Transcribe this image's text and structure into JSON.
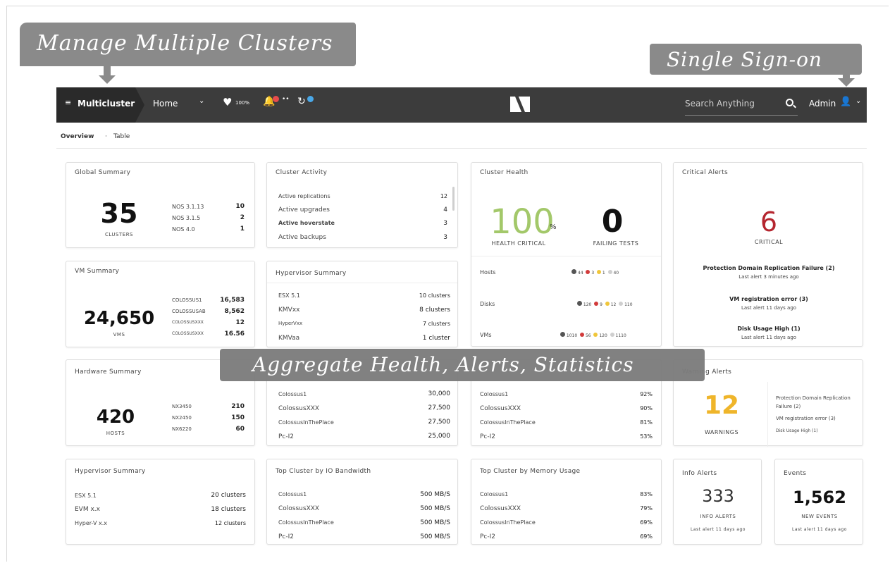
{
  "callouts": {
    "manage_multiple_clusters": "Manage Multiple Clusters",
    "single_sign_on": "Single Sign-on",
    "aggregate": "Aggregate Health, Alerts, Statistics"
  },
  "topbar": {
    "brand": "Multicluster",
    "home": "Home",
    "health_pct": "100%",
    "alerts_counter": "••",
    "search_placeholder": "Search Anything",
    "admin": "Admin"
  },
  "subnav": {
    "overview": "Overview",
    "separator": "·",
    "table": "Table"
  },
  "global_summary": {
    "title": "Global Summary",
    "value": "35",
    "label": "CLUSTERS",
    "rows": [
      {
        "name": "NOS 3.1.13",
        "value": "10"
      },
      {
        "name": "NOS 3.1.5",
        "value": "2"
      },
      {
        "name": "NOS 4.0",
        "value": "1"
      }
    ]
  },
  "cluster_activity": {
    "title": "Cluster Activity",
    "rows": [
      {
        "name": "Active replications",
        "value": "12"
      },
      {
        "name": "Active upgrades",
        "value": "4"
      },
      {
        "name": "Active hoverstate",
        "value": "3"
      },
      {
        "name": "Active backups",
        "value": "3"
      }
    ]
  },
  "cluster_health": {
    "title": "Cluster Health",
    "health_value": "100",
    "health_unit": "%",
    "health_label": "HEALTH CRITICAL",
    "failing_value": "0",
    "failing_label": "FAILING TESTS",
    "rows": [
      {
        "name": "Hosts",
        "counts": [
          "44",
          "3",
          "1",
          "40"
        ]
      },
      {
        "name": "Disks",
        "counts": [
          "120",
          "9",
          "12",
          "110"
        ]
      },
      {
        "name": "VMs",
        "counts": [
          "1010",
          "56",
          "120",
          "1110"
        ]
      }
    ]
  },
  "critical_alerts": {
    "title": "Critical Alerts",
    "value": "6",
    "label": "CRITICAL",
    "items": [
      {
        "name": "Protection Domain Replication Failure (2)",
        "meta": "Last alert 3 minutes ago"
      },
      {
        "name": "VM registration error (3)",
        "meta": "Last alert 11 days ago"
      },
      {
        "name": "Disk Usage High (1)",
        "meta": "Last alert 11 days ago"
      }
    ]
  },
  "vm_summary": {
    "title": "VM Summary",
    "value": "24,650",
    "label": "VMS",
    "rows": [
      {
        "name": "COLOSSUS1",
        "value": "16,583"
      },
      {
        "name": "COLOSSUSAB",
        "value": "8,562"
      },
      {
        "name": "COLOSSUSXXX",
        "value": "12"
      },
      {
        "name": "COLOSSUSXXX",
        "value": "16.56"
      }
    ]
  },
  "hypervisor_summary_top": {
    "title": "Hypervisor Summary",
    "rows": [
      {
        "name": "ESX 5.1",
        "value": "10 clusters"
      },
      {
        "name": "KMVxx",
        "value": "8 clusters"
      },
      {
        "name": "HyperVxx",
        "value": "7 clusters"
      },
      {
        "name": "KMVaa",
        "value": "1 cluster"
      }
    ]
  },
  "hardware_summary": {
    "title": "Hardware Summary",
    "value": "420",
    "label": "HOSTS",
    "rows": [
      {
        "name": "NX3450",
        "value": "210"
      },
      {
        "name": "NX2450",
        "value": "150"
      },
      {
        "name": "NX6220",
        "value": "60"
      }
    ]
  },
  "top_iops": {
    "rows": [
      {
        "name": "Colossus1",
        "value": "30,000"
      },
      {
        "name": "ColossusXXX",
        "value": "27,500"
      },
      {
        "name": "ColossusInThePlace",
        "value": "27,500"
      },
      {
        "name": "Pc-I2",
        "value": "25,000"
      }
    ]
  },
  "top_cpu": {
    "rows": [
      {
        "name": "Colossus1",
        "value": "92%"
      },
      {
        "name": "ColossusXXX",
        "value": "90%"
      },
      {
        "name": "ColossusInThePlace",
        "value": "81%"
      },
      {
        "name": "Pc-I2",
        "value": "53%"
      }
    ]
  },
  "warning_alerts": {
    "title": "Warning Alerts",
    "value": "12",
    "label": "WARNINGS",
    "items": [
      "Protection Domain Replication Failure (2)",
      "VM registration error (3)",
      "Disk Usage High (1)"
    ]
  },
  "hypervisor_summary_bottom": {
    "title": "Hypervisor Summary",
    "rows": [
      {
        "name": "ESX 5.1",
        "value": "20 clusters"
      },
      {
        "name": "EVM x.x",
        "value": "18 clusters"
      },
      {
        "name": "Hyper-V x.x",
        "value": "12 clusters"
      }
    ]
  },
  "top_io_bandwidth": {
    "title": "Top Cluster by IO Bandwidth",
    "rows": [
      {
        "name": "Colossus1",
        "value": "500 MB/S"
      },
      {
        "name": "ColossusXXX",
        "value": "500 MB/S"
      },
      {
        "name": "ColossusInThePlace",
        "value": "500 MB/S"
      },
      {
        "name": "Pc-I2",
        "value": "500 MB/S"
      }
    ]
  },
  "top_memory": {
    "title": "Top Cluster by Memory Usage",
    "rows": [
      {
        "name": "Colossus1",
        "value": "83%"
      },
      {
        "name": "ColossusXXX",
        "value": "79%"
      },
      {
        "name": "ColossusInThePlace",
        "value": "69%"
      },
      {
        "name": "Pc-I2",
        "value": "69%"
      }
    ]
  },
  "info_alerts": {
    "title": "Info Alerts",
    "value": "333",
    "label": "INFO ALERTS",
    "meta": "Last alert 11 days ago"
  },
  "events": {
    "title": "Events",
    "value": "1,562",
    "label": "NEW EVENTS",
    "meta": "Last alert 11 days ago"
  },
  "colors": {
    "health_green": "#a3c86a",
    "critical_red": "#b5262f",
    "warning_yellow": "#efb52a",
    "dot_red": "#d23b3b",
    "dot_yellow": "#f0c63a",
    "dot_gray": "#cfcfcf",
    "dot_dark": "#555555",
    "topbar": "#3c3c3c",
    "alert_bell": "#e84c4c",
    "badge_blue": "#4aa8e8"
  }
}
